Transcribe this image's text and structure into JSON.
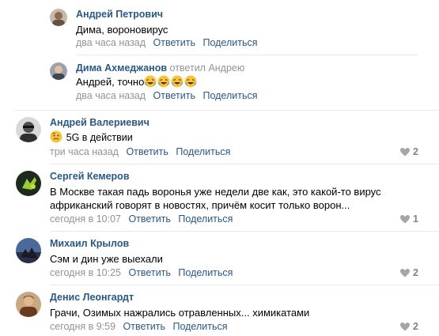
{
  "comments": [
    {
      "author": "Андрей Петрович",
      "replied_to": "",
      "text": "Дима, вороновирус",
      "time": "два часа назад",
      "reply_label": "Ответить",
      "share_label": "Поделиться",
      "likes": "",
      "avatar_icon": "avatar-photo-icon",
      "avatar_color": "#b0a090"
    },
    {
      "author": "Дима Ахмеджанов",
      "replied_to": "ответил Андрею",
      "text": "Андрей, точно",
      "emoji_name": "rofl-emoji",
      "emoji_count": 4,
      "time": "два часа назад",
      "reply_label": "Ответить",
      "share_label": "Поделиться",
      "likes": "",
      "avatar_icon": "avatar-photo-icon",
      "avatar_color": "#6a6f80"
    },
    {
      "author": "Андрей Валериевич",
      "replied_to": "",
      "text": "5G в действии",
      "emoji_name": "thinking-emoji",
      "time": "три часа назад",
      "reply_label": "Ответить",
      "share_label": "Поделиться",
      "likes": "2",
      "avatar_icon": "avatar-photo-icon",
      "avatar_color": "#8a8a8a"
    },
    {
      "author": "Сергей Кемеров",
      "replied_to": "",
      "text_line1": "В Москве такая падь воронья уже недели две как, это какой-то вирус",
      "text_line2": "африканский говорят в новостях, причём косит только ворон...",
      "time": "сегодня в 10:07",
      "reply_label": "Ответить",
      "share_label": "Поделиться",
      "likes": "1",
      "avatar_icon": "avatar-photo-icon",
      "avatar_color": "#2e3a2a"
    },
    {
      "author": "Михаил Крылов",
      "replied_to": "",
      "text": "Сэм и дин уже выехали",
      "time": "сегодня в 10:25",
      "reply_label": "Ответить",
      "share_label": "Поделиться",
      "likes": "2",
      "avatar_icon": "avatar-photo-icon",
      "avatar_color": "#3a4a6a"
    },
    {
      "author": "Денис Леонгардт",
      "replied_to": "",
      "text": "Грачи, Озимых нажрались отравленных... химикатами",
      "time": "сегодня в 9:59",
      "reply_label": "Ответить",
      "share_label": "Поделиться",
      "likes": "2",
      "avatar_icon": "avatar-photo-icon",
      "avatar_color": "#7a5a40"
    }
  ],
  "colors": {
    "link": "#2a5885",
    "meta": "#939393",
    "divider": "#e7e8ec",
    "heart": "#a5a5a5"
  }
}
